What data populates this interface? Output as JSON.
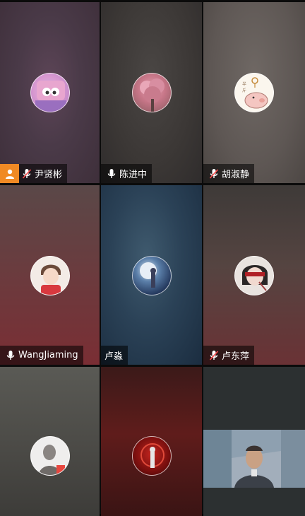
{
  "participants": [
    {
      "name": "尹贤彬",
      "mic": "muted",
      "host": true,
      "avatar": "cartoon-pink-avatar"
    },
    {
      "name": "陈进中",
      "mic": "on",
      "host": false,
      "avatar": "pink-blossom-tree-avatar"
    },
    {
      "name": "胡淑静",
      "mic": "muted",
      "host": false,
      "avatar": "piggy-cartoon-avatar"
    },
    {
      "name": "WangJiaming",
      "mic": "on",
      "host": false,
      "avatar": "anime-boy-avatar"
    },
    {
      "name": "卢淼",
      "mic": "none",
      "host": false,
      "avatar": "moon-night-anime-avatar"
    },
    {
      "name": "卢东萍",
      "mic": "muted",
      "host": false,
      "avatar": "blindfold-girl-avatar"
    },
    {
      "name": "",
      "mic": "none",
      "host": false,
      "avatar": "portrait-man-avatar"
    },
    {
      "name": "",
      "mic": "none",
      "host": false,
      "avatar": "red-fantasy-avatar"
    },
    {
      "name": "",
      "mic": "none",
      "host": false,
      "video": "live-camera-feed"
    }
  ],
  "icons": {
    "host": "person-icon",
    "mic_on": "microphone-icon",
    "mic_muted": "microphone-muted-icon"
  },
  "colors": {
    "host_badge": "#f08a24",
    "name_tag_bg": "rgba(0,0,0,0.55)",
    "mute_slash": "#ff4d4d"
  }
}
